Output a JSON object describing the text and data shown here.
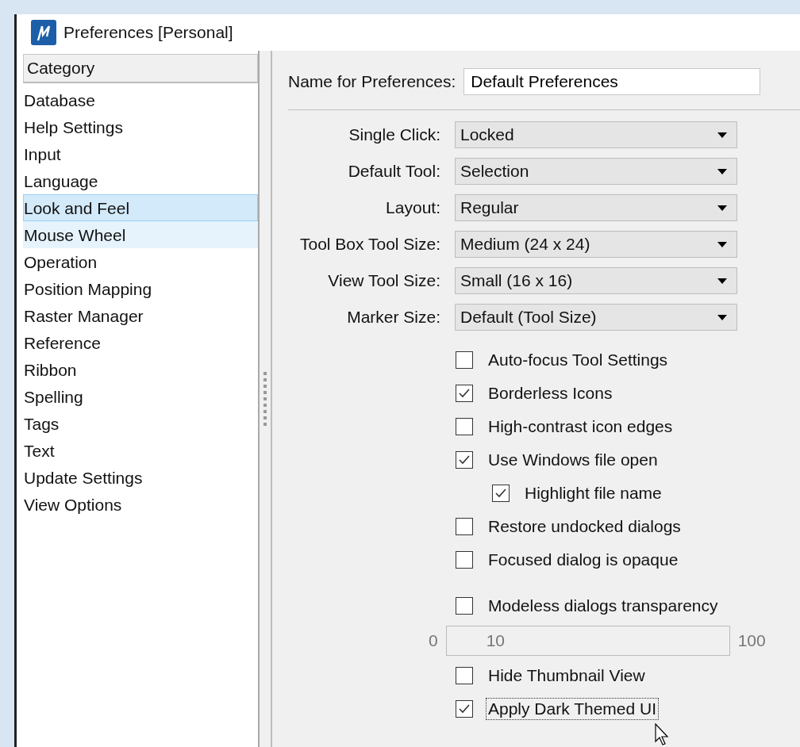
{
  "window": {
    "title": "Preferences [Personal]"
  },
  "category": {
    "header": "Category",
    "items": [
      {
        "label": "Database",
        "selected": false,
        "hovered": false
      },
      {
        "label": "Help Settings",
        "selected": false,
        "hovered": false
      },
      {
        "label": "Input",
        "selected": false,
        "hovered": false
      },
      {
        "label": "Language",
        "selected": false,
        "hovered": false
      },
      {
        "label": "Look and Feel",
        "selected": true,
        "hovered": false
      },
      {
        "label": "Mouse Wheel",
        "selected": false,
        "hovered": true
      },
      {
        "label": "Operation",
        "selected": false,
        "hovered": false
      },
      {
        "label": "Position Mapping",
        "selected": false,
        "hovered": false
      },
      {
        "label": "Raster Manager",
        "selected": false,
        "hovered": false
      },
      {
        "label": "Reference",
        "selected": false,
        "hovered": false
      },
      {
        "label": "Ribbon",
        "selected": false,
        "hovered": false
      },
      {
        "label": "Spelling",
        "selected": false,
        "hovered": false
      },
      {
        "label": "Tags",
        "selected": false,
        "hovered": false
      },
      {
        "label": "Text",
        "selected": false,
        "hovered": false
      },
      {
        "label": "Update Settings",
        "selected": false,
        "hovered": false
      },
      {
        "label": "View Options",
        "selected": false,
        "hovered": false
      }
    ]
  },
  "name_field": {
    "label": "Name for Preferences:",
    "value": "Default Preferences"
  },
  "dropdowns": [
    {
      "label": "Single Click:",
      "value": "Locked"
    },
    {
      "label": "Default Tool:",
      "value": "Selection"
    },
    {
      "label": "Layout:",
      "value": "Regular"
    },
    {
      "label": "Tool Box Tool Size:",
      "value": "Medium (24 x 24)"
    },
    {
      "label": "View Tool Size:",
      "value": "Small (16 x 16)"
    },
    {
      "label": "Marker Size:",
      "value": "Default (Tool Size)"
    }
  ],
  "options": [
    {
      "label": "Auto-focus Tool Settings",
      "checked": false,
      "focused": false
    },
    {
      "label": "Borderless Icons",
      "checked": true,
      "focused": false
    },
    {
      "label": "High-contrast icon edges",
      "checked": false,
      "focused": false
    },
    {
      "label": "Use Windows file open",
      "checked": true,
      "focused": false,
      "children": [
        {
          "label": "Highlight file name",
          "checked": true,
          "focused": false
        }
      ]
    },
    {
      "label": "Restore undocked dialogs",
      "checked": false,
      "focused": false
    },
    {
      "label": "Focused dialog is opaque",
      "checked": false,
      "focused": false
    }
  ],
  "transparency": {
    "option": {
      "label": "Modeless dialogs transparency",
      "checked": false,
      "focused": false
    },
    "min": "0",
    "value": "10",
    "max": "100",
    "disabled": true
  },
  "more_options": [
    {
      "label": "Hide Thumbnail View",
      "checked": false,
      "focused": false
    },
    {
      "label": "Apply Dark Themed UI",
      "checked": true,
      "focused": true
    }
  ]
}
